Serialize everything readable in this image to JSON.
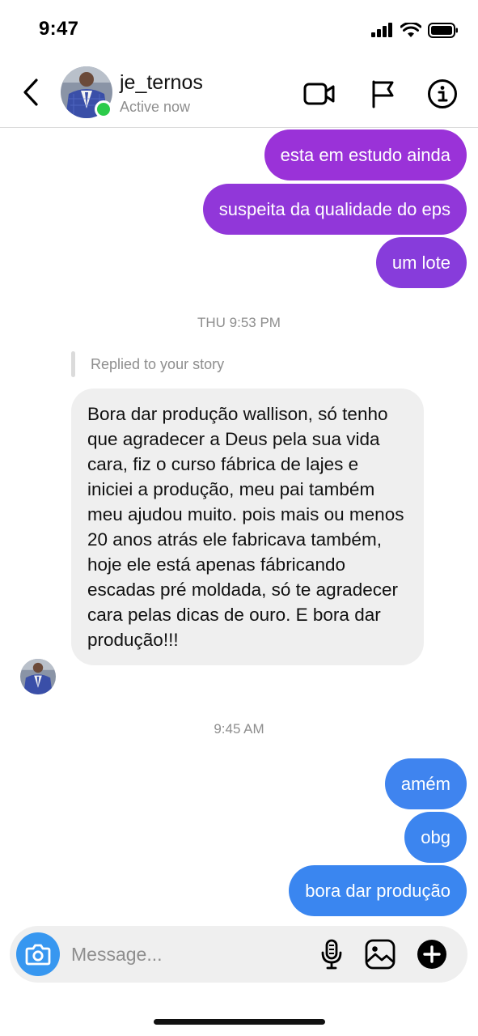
{
  "status_bar": {
    "time": "9:47"
  },
  "header": {
    "name": "je_ternos",
    "status": "Active now"
  },
  "colors": {
    "outgoing_top": "#9b30d9",
    "outgoing_bottom": "#3b86f0",
    "online": "#2ccb4a",
    "accent": "#3797f0"
  },
  "messages": {
    "out_1": "esta em estudo ainda",
    "out_2": "suspeita da qualidade do eps",
    "out_3": "um lote",
    "timestamp_1": "THU 9:53 PM",
    "reply_label": "Replied to your story",
    "in_1": "Bora dar produção wallison, só tenho que agradecer a Deus pela sua vida cara, fiz o curso fábrica de lajes e iniciei a produção, meu pai também meu ajudou muito. pois mais ou menos 20 anos atrás ele fabricava também, hoje ele está apenas fábricando escadas pré moldada, só te agradecer cara pelas dicas de ouro. E bora dar produção!!!",
    "timestamp_2": "9:45 AM",
    "out_4": "amém",
    "out_5": "obg",
    "out_6": "bora dar produção"
  },
  "composer": {
    "placeholder": "Message..."
  },
  "icons": {
    "back": "chevron-left-icon",
    "video": "video-camera-icon",
    "flag": "flag-icon",
    "info": "info-icon",
    "camera": "camera-icon",
    "mic": "microphone-icon",
    "gallery": "image-icon",
    "add": "plus-circle-icon"
  }
}
